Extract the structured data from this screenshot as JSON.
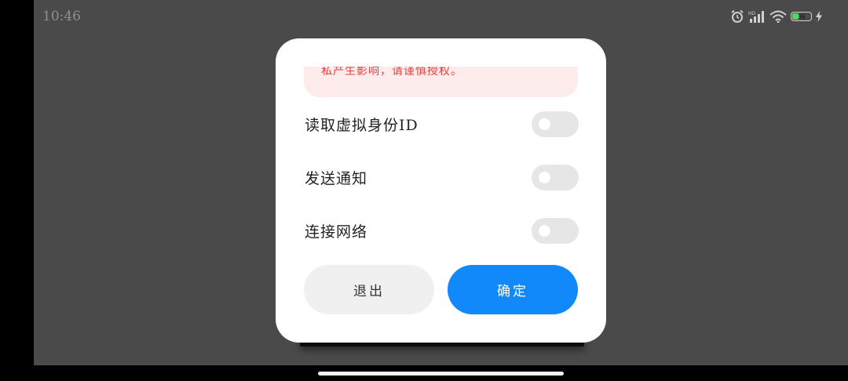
{
  "status_bar": {
    "time": "10:46",
    "network_type": "HD",
    "battery_level": "36",
    "battery_fraction": 0.36,
    "colors": {
      "battery_fill": "#4cd964"
    }
  },
  "dialog": {
    "notice_text": "私产生影响，请谨慎授权。",
    "permissions": [
      {
        "label": "读取虚拟身份ID",
        "enabled": false
      },
      {
        "label": "发送通知",
        "enabled": false
      },
      {
        "label": "连接网络",
        "enabled": false
      }
    ],
    "exit_label": "退出",
    "confirm_label": "确定",
    "colors": {
      "accent": "#1189fb",
      "warning": "#e2403c",
      "warning_bg": "#fdeceb"
    }
  }
}
